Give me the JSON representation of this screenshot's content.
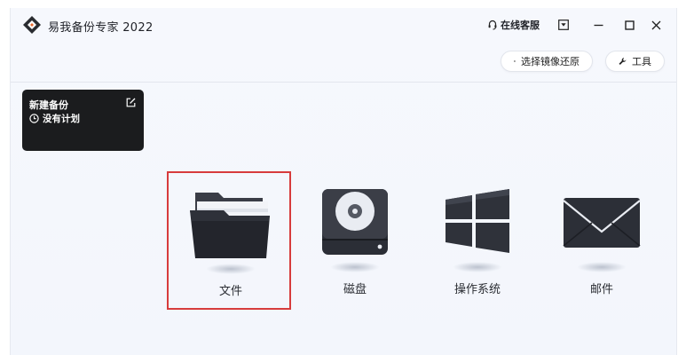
{
  "app": {
    "title": "易我备份专家 2022",
    "accent_color": "#e8692e"
  },
  "titlebar": {
    "support_label": "在线客服",
    "support_icon": "headset-icon",
    "menu_icon": "dropdown-menu-icon",
    "minimize_icon": "minimize-icon",
    "maximize_icon": "maximize-icon",
    "close_icon": "close-icon"
  },
  "toolbar": {
    "restore_label": "选择镜像还原",
    "tools_label": "工具"
  },
  "backup_card": {
    "title": "新建备份",
    "schedule": "没有计划"
  },
  "options": [
    {
      "label": "文件",
      "icon": "folder-icon",
      "selected": true
    },
    {
      "label": "磁盘",
      "icon": "disk-icon",
      "selected": false
    },
    {
      "label": "操作系统",
      "icon": "windows-icon",
      "selected": false
    },
    {
      "label": "邮件",
      "icon": "mail-icon",
      "selected": false
    }
  ],
  "colors": {
    "selection_border": "#d73c3c",
    "card_bg": "#1b1c1e"
  }
}
